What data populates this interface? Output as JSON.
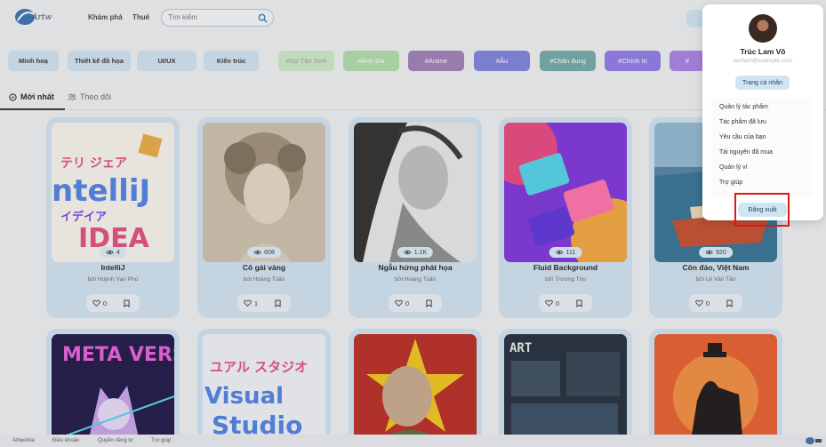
{
  "header": {
    "logo_alt": "Artworkie",
    "nav": [
      "Khám phá",
      "Thuê"
    ],
    "search_placeholder": "Tìm kiếm"
  },
  "categories": [
    {
      "label": "Minh hoạ",
      "color": "#cfe1ee"
    },
    {
      "label": "Thiết kế đồ họa",
      "color": "#cfe1ee"
    },
    {
      "label": "UI/UX",
      "color": "#cfe1ee"
    },
    {
      "label": "Kiến trúc",
      "color": "#cfe1ee"
    },
    {
      "label": "#Sự Tận Sinh",
      "color": "#cbe8c4"
    },
    {
      "label": "#Ảnh bìa",
      "color": "#aedba5"
    },
    {
      "label": "#Anime",
      "color": "#9b7db3"
    },
    {
      "label": "#Âu",
      "color": "#7a7fd6"
    },
    {
      "label": "#Chân dung",
      "color": "#6fa6a4"
    },
    {
      "label": "#Chính trị",
      "color": "#8d77e3"
    },
    {
      "label": "#",
      "color": "#a77ee0"
    }
  ],
  "tabs": [
    {
      "label": "Mới nhất",
      "active": true
    },
    {
      "label": "Theo dõi",
      "active": false
    }
  ],
  "artworks": [
    {
      "title": "IntelliJ",
      "author": "bởi Huỳnh Vạn Phú",
      "views": "4",
      "likes": "0"
    },
    {
      "title": "Cô gái vàng",
      "author": "bởi Hoàng Tuấn",
      "views": "608",
      "likes": "1"
    },
    {
      "title": "Ngẫu hứng phát họa",
      "author": "bởi Hoàng Tuấn",
      "views": "1.1K",
      "likes": "0"
    },
    {
      "title": "Fluid Background",
      "author": "bởi Trương Thu",
      "views": "111",
      "likes": "0"
    },
    {
      "title": "Côn đảo, Việt Nam",
      "author": "bởi Lê Văn Tân",
      "views": "920",
      "likes": "0"
    }
  ],
  "second_row": [
    {
      "thumb_text": "META VERSE"
    },
    {
      "thumb_text": "Visual Studio"
    },
    {
      "thumb_text": ""
    },
    {
      "thumb_text": "ART"
    },
    {
      "thumb_text": ""
    }
  ],
  "footer": {
    "links": [
      "Artworkie",
      "Điều khoản",
      "Quyền riêng tư",
      "Trợ giúp"
    ]
  },
  "user_menu": {
    "name": "Trúc Lam Võ",
    "email": "lamlam@example.com",
    "profile_button": "Trang cá nhân",
    "items": [
      "Quản lý tác phẩm",
      "Tác phẩm đã lưu",
      "Yêu cầu của bạn",
      "Tài nguyên đã mua",
      "Quản lý ví",
      "Trợ giúp"
    ],
    "logout_button": "Đăng xuất"
  },
  "colors": {
    "accent": "#cfe6f2",
    "highlight": "#e01616"
  }
}
